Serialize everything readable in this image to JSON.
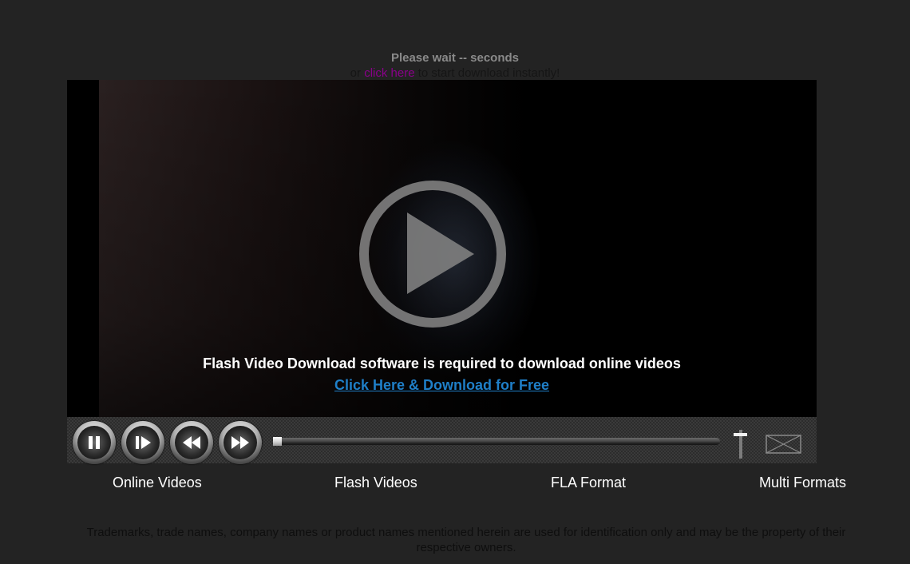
{
  "header": {
    "wait_text": "Please wait -- seconds",
    "sub_prefix": "or ",
    "click_here_label": "click here",
    "sub_suffix": " to start download instantly!",
    "link_color": "#8a008a"
  },
  "player": {
    "overlay_message": "Flash Video Download software is required to download online videos",
    "download_link_label": "Click Here & Download for Free",
    "link_color": "#1f7fc8",
    "play_icon": "play-circle-icon",
    "controls": {
      "buttons": [
        {
          "name": "pause",
          "icon": "pause-icon"
        },
        {
          "name": "step-forward",
          "icon": "step-forward-icon"
        },
        {
          "name": "rewind",
          "icon": "rewind-icon"
        },
        {
          "name": "fast-forward",
          "icon": "fast-forward-icon"
        }
      ],
      "seek_progress": 0,
      "volume_icon": "volume-slider-icon",
      "share_icon": "envelope-icon"
    }
  },
  "features": [
    {
      "label": "Online Videos"
    },
    {
      "label": "Flash Videos"
    },
    {
      "label": "FLA Format"
    },
    {
      "label": "Multi Formats"
    }
  ],
  "footer": {
    "disclaimer": "Trademarks, trade names, company names or product names mentioned herein are used for identification only and may be the property of their respective owners."
  }
}
